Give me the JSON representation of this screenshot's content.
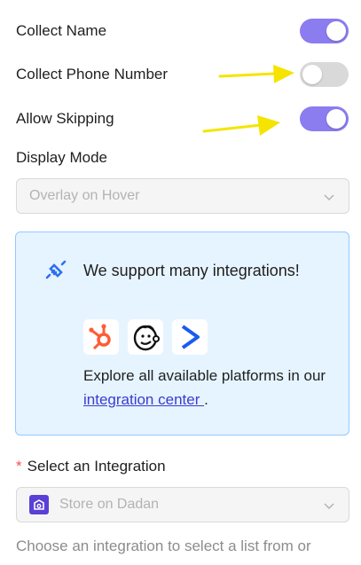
{
  "toggles": [
    {
      "label": "Collect Name",
      "on": true
    },
    {
      "label": "Collect Phone Number",
      "on": false
    },
    {
      "label": "Allow Skipping",
      "on": true
    }
  ],
  "display_mode": {
    "label": "Display Mode",
    "value": "Overlay on Hover"
  },
  "integrations_box": {
    "title": "We support many integrations!",
    "logos": [
      "hubspot-logo",
      "mailchimp-logo",
      "activecampaign-logo"
    ],
    "desc_prefix": "Explore all available platforms in our ",
    "link_text": "integration center ",
    "desc_suffix": "."
  },
  "integration_select": {
    "required_mark": "*",
    "label": "Select an Integration",
    "value": "Store on Dadan"
  },
  "help_text": "Choose an integration to select a list from or",
  "colors": {
    "toggle_on": "#8b7cf0",
    "toggle_off": "#d9d9d9",
    "arrow": "#f5e400",
    "link": "#3b3bd1",
    "info_bg": "#e6f4ff",
    "info_border": "#91caff"
  }
}
